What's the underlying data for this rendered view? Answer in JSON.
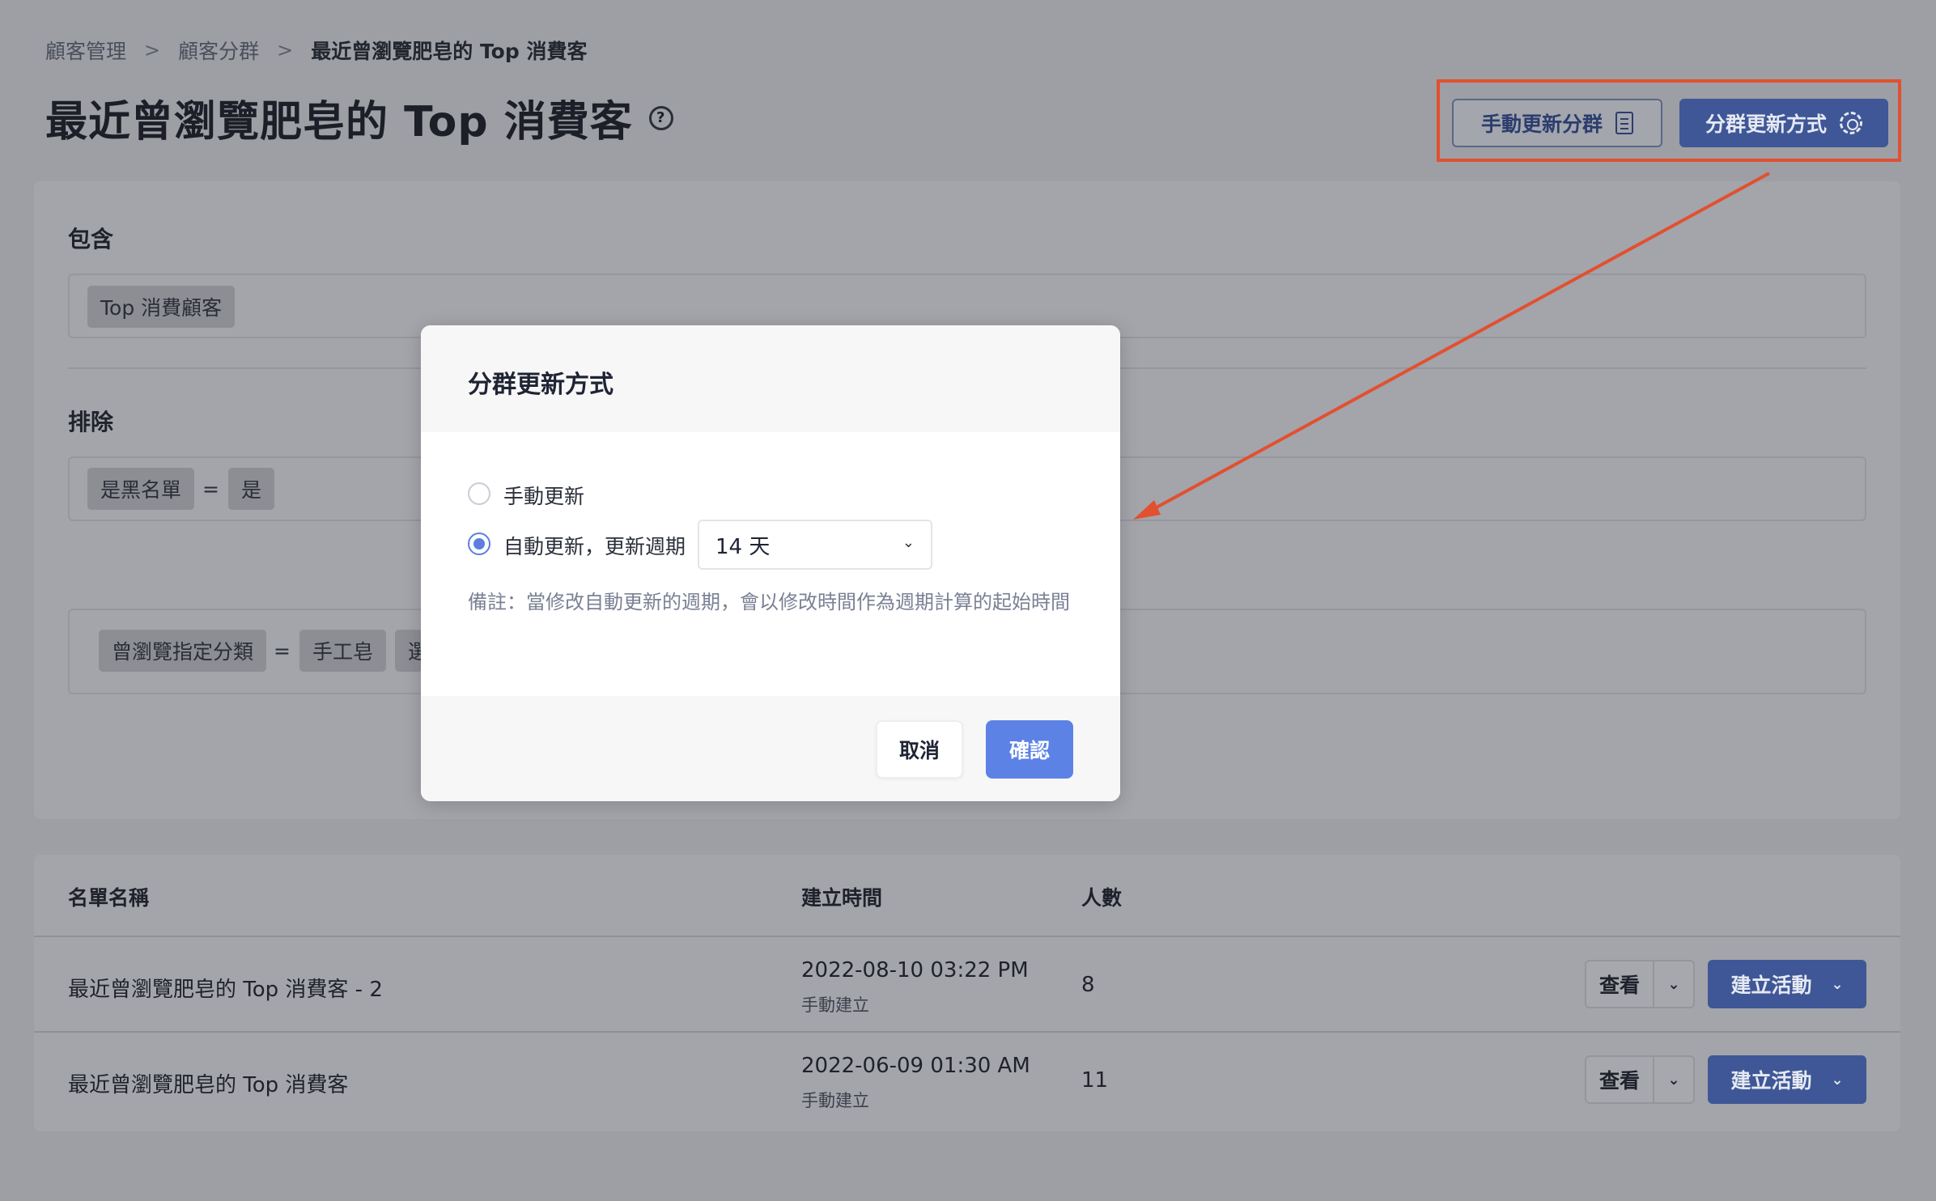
{
  "breadcrumb": {
    "items": [
      "顧客管理",
      "顧客分群",
      "最近曾瀏覽肥皂的 Top 消費客"
    ],
    "separator": ">"
  },
  "page": {
    "title": "最近曾瀏覽肥皂的 Top 消費客",
    "help_symbol": "?"
  },
  "toolbar": {
    "manual_update_label": "手動更新分群",
    "update_method_label": "分群更新方式"
  },
  "conditions": {
    "include_label": "包含",
    "include_tags": [
      "Top 消費顧客"
    ],
    "exclude_label": "排除",
    "exclude_rule": {
      "field": "是黑名單",
      "op": "=",
      "value": "是"
    },
    "browse_rule": {
      "field": "曾瀏覽指定分類",
      "op": "=",
      "value": "手工皂",
      "more": "選"
    }
  },
  "table": {
    "headers": [
      "名單名稱",
      "建立時間",
      "人數"
    ],
    "rows": [
      {
        "name": "最近曾瀏覽肥皂的 Top 消費客 - 2",
        "created": "2022-08-10 03:22 PM",
        "created_by": "手動建立",
        "count": "8",
        "view_label": "查看",
        "action_label": "建立活動"
      },
      {
        "name": "最近曾瀏覽肥皂的 Top 消費客",
        "created": "2022-06-09 01:30 AM",
        "created_by": "手動建立",
        "count": "11",
        "view_label": "查看",
        "action_label": "建立活動"
      }
    ]
  },
  "modal": {
    "title": "分群更新方式",
    "option_manual": "手動更新",
    "option_auto": "自動更新，更新週期",
    "selected_option": "auto",
    "period_value": "14 天",
    "note": "備註：當修改自動更新的週期，會以修改時間作為週期計算的起始時間",
    "cancel_label": "取消",
    "confirm_label": "確認"
  },
  "colors": {
    "primary": "#3f5796",
    "confirm": "#5c82e6",
    "annotation": "#e25030"
  }
}
